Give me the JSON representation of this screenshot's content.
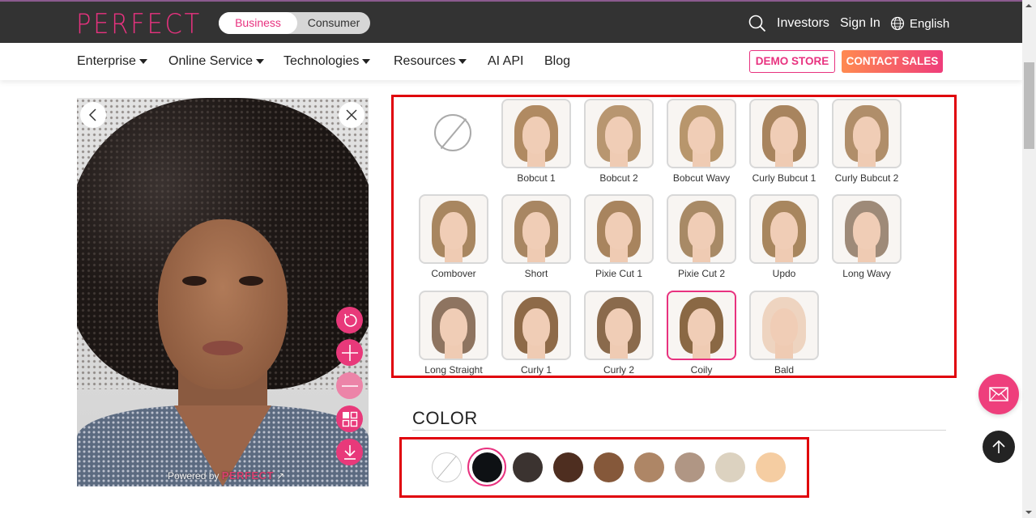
{
  "header": {
    "logo": "PERFECT",
    "toggle": {
      "active": "Business",
      "inactive": "Consumer"
    },
    "search_icon": "search-icon",
    "investors": "Investors",
    "sign_in": "Sign In",
    "language": "English",
    "language_icon": "globe-icon"
  },
  "nav": {
    "items": [
      {
        "label": "Enterprise",
        "dropdown": true
      },
      {
        "label": "Online Service",
        "dropdown": true
      },
      {
        "label": "Technologies",
        "dropdown": true
      },
      {
        "label": "Resources",
        "dropdown": true
      },
      {
        "label": "AI API",
        "dropdown": false
      },
      {
        "label": "Blog",
        "dropdown": false
      }
    ],
    "demo_store": "DEMO STORE",
    "contact_sales": "CONTACT SALES"
  },
  "preview": {
    "powered_by": "Powered by",
    "powered_brand": "PERFECT",
    "tools": [
      "reset-icon",
      "zoom-in-icon",
      "zoom-out-icon",
      "compare-grid-icon",
      "download-icon"
    ]
  },
  "hairstyles": {
    "selected": "Coily",
    "items": [
      {
        "label": "Bobcut 1",
        "hair": "#b08a62"
      },
      {
        "label": "Bobcut 2",
        "hair": "#b89670"
      },
      {
        "label": "Bobcut Wavy",
        "hair": "#b8966c"
      },
      {
        "label": "Curly Bubcut 1",
        "hair": "#a8845e"
      },
      {
        "label": "Curly Bubcut 2",
        "hair": "#b08e6a"
      },
      {
        "label": "Combover",
        "hair": "#a88660"
      },
      {
        "label": "Short",
        "hair": "#a88662"
      },
      {
        "label": "Pixie Cut 1",
        "hair": "#a8845e"
      },
      {
        "label": "Pixie Cut 2",
        "hair": "#a88a66"
      },
      {
        "label": "Updo",
        "hair": "#a8865e"
      },
      {
        "label": "Long Wavy",
        "hair": "#9e8a78"
      },
      {
        "label": "Long Straight",
        "hair": "#8e7460"
      },
      {
        "label": "Curly 1",
        "hair": "#8e6a48"
      },
      {
        "label": "Curly 2",
        "hair": "#8a6a4c"
      },
      {
        "label": "Coily",
        "hair": "#8a6844"
      },
      {
        "label": "Bald",
        "hair": "#eed4c0"
      }
    ]
  },
  "color": {
    "title": "COLOR",
    "selected_index": 1,
    "swatches": [
      "none",
      "#0e1114",
      "#3b3330",
      "#4e2e20",
      "#85583a",
      "#ae8666",
      "#b09684",
      "#dcd2c0",
      "#f5cda2"
    ]
  },
  "floating": {
    "mail_icon": "mail-icon",
    "top_icon": "arrow-up-icon"
  }
}
